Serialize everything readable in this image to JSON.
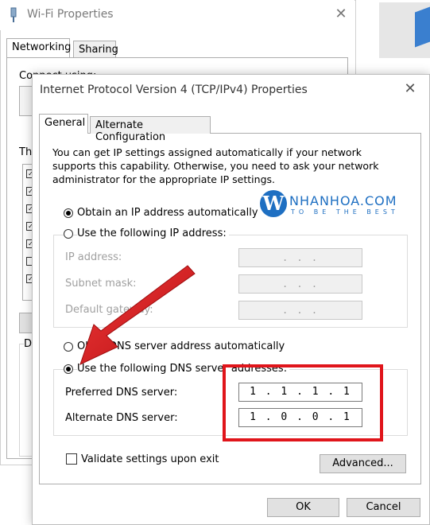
{
  "wifi_window": {
    "title": "Wi-Fi Properties",
    "tabs": [
      "Networking",
      "Sharing"
    ],
    "connect_label": "Connect using:",
    "this_label": "Th",
    "desc_label": "D"
  },
  "ipv4_dialog": {
    "title": "Internet Protocol Version 4 (TCP/IPv4) Properties",
    "tabs": {
      "general": "General",
      "alternate": "Alternate Configuration"
    },
    "intro": "You can get IP settings assigned automatically if your network supports this capability. Otherwise, you need to ask your network administrator for the appropriate IP settings.",
    "ip": {
      "auto_label": "Obtain an IP address automatically",
      "manual_label": "Use the following IP address:",
      "selected": "auto",
      "fields": [
        {
          "label": "IP address:",
          "value": ". . ."
        },
        {
          "label": "Subnet mask:",
          "value": ". . ."
        },
        {
          "label": "Default gateway:",
          "value": ". . ."
        }
      ]
    },
    "dns": {
      "auto_label": "Obtain DNS server address automatically",
      "auto_visible_left": "Ob",
      "auto_visible_right": "DNS server address automatically",
      "manual_label": "Use the following DNS server addresses:",
      "selected": "manual",
      "preferred_label": "Preferred DNS server:",
      "preferred_value": "1 . 1 . 1 . 1",
      "alternate_label": "Alternate DNS server:",
      "alternate_value": "1 . 0 . 0 . 1"
    },
    "validate_label": "Validate settings upon exit",
    "advanced_label": "Advanced...",
    "ok_label": "OK",
    "cancel_label": "Cancel"
  },
  "watermark": {
    "letter": "W",
    "name": "NHANHOA.COM",
    "slogan": "TO BE THE BEST"
  },
  "colors": {
    "highlight": "#e0151b",
    "watermark": "#1e6fc2"
  }
}
